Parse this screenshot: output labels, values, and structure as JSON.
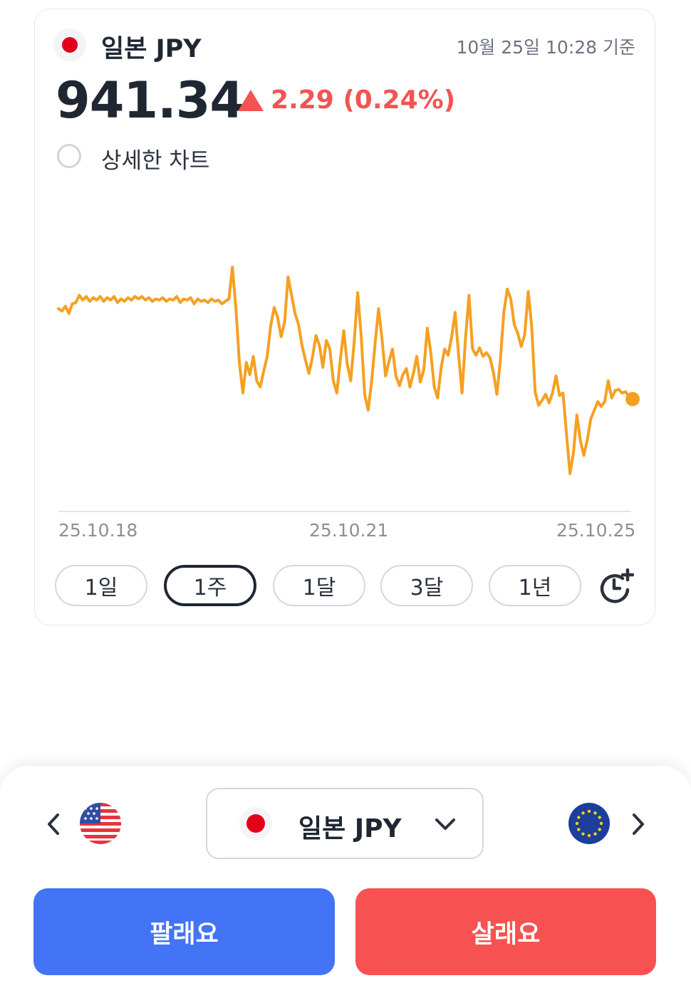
{
  "currency": {
    "title": "일본 JPY",
    "timestamp": "10월 25일 10:28 기준",
    "price": "941.34",
    "change": "2.29 (0.24%)",
    "change_direction": "up",
    "flag_icon": "japan-flag-icon"
  },
  "detail_toggle": {
    "label": "상세한 차트",
    "checked": false
  },
  "chart_data": {
    "type": "line",
    "color": "#f5a023",
    "x_ticks": [
      "25.10.18",
      "25.10.21",
      "25.10.25"
    ],
    "series": [
      {
        "values": [
          938.9,
          938.7,
          939.1,
          938.5,
          939.3,
          939.4,
          940.0,
          939.6,
          939.9,
          939.5,
          939.8,
          939.6,
          939.9,
          939.5,
          939.8,
          939.6,
          939.9,
          939.4,
          939.7,
          939.5,
          939.8,
          939.6,
          939.9,
          939.7,
          939.9,
          939.6,
          939.8,
          939.5,
          939.7,
          939.6,
          939.8,
          939.5,
          939.7,
          939.6,
          939.9,
          939.4,
          939.7,
          939.6,
          939.8,
          939.3,
          939.7,
          939.5,
          939.6,
          939.4,
          939.7,
          939.5,
          939.6,
          939.3,
          939.5,
          939.7,
          942.3,
          939.0,
          934.5,
          932.0,
          934.5,
          933.5,
          935.0,
          933.0,
          932.5,
          933.8,
          935.0,
          937.5,
          939.0,
          938.2,
          936.6,
          937.8,
          941.5,
          940.0,
          938.5,
          937.6,
          935.9,
          934.7,
          933.6,
          934.9,
          936.7,
          935.9,
          934.1,
          936.3,
          935.6,
          933.0,
          932.0,
          934.7,
          937.1,
          934.4,
          933.0,
          936.2,
          940.2,
          936.7,
          931.9,
          930.6,
          932.9,
          936.0,
          938.9,
          936.4,
          933.4,
          934.6,
          935.6,
          933.4,
          932.6,
          933.5,
          934.0,
          932.5,
          933.6,
          935.0,
          932.9,
          933.9,
          937.3,
          935.3,
          932.5,
          931.6,
          934.1,
          935.6,
          935.1,
          936.6,
          938.6,
          935.1,
          932.0,
          936.5,
          940.0,
          935.6,
          935.1,
          935.7,
          935.0,
          935.3,
          934.9,
          933.7,
          931.9,
          934.7,
          938.6,
          940.5,
          939.7,
          937.6,
          936.9,
          935.8,
          936.8,
          940.3,
          937.5,
          932.1,
          931.0,
          931.4,
          931.9,
          931.2,
          932.0,
          933.4,
          931.8,
          932.0,
          928.7,
          925.4,
          927.1,
          930.2,
          928.1,
          926.9,
          928.2,
          929.9,
          930.6,
          931.3,
          930.9,
          931.3,
          933.0,
          931.6,
          932.2,
          932.3,
          932.0,
          932.1,
          931.7,
          931.5
        ]
      }
    ]
  },
  "periods": [
    {
      "label": "1일",
      "active": false
    },
    {
      "label": "1주",
      "active": true
    },
    {
      "label": "1달",
      "active": false
    },
    {
      "label": "3달",
      "active": false
    },
    {
      "label": "1년",
      "active": false
    }
  ],
  "selector": {
    "label": "일본 JPY",
    "prev_flag": "us-flag-icon",
    "next_flag": "eu-flag-icon"
  },
  "actions": {
    "sell": "팔래요",
    "buy": "살래요",
    "sell_color": "#4274f5",
    "buy_color": "#f65252"
  }
}
